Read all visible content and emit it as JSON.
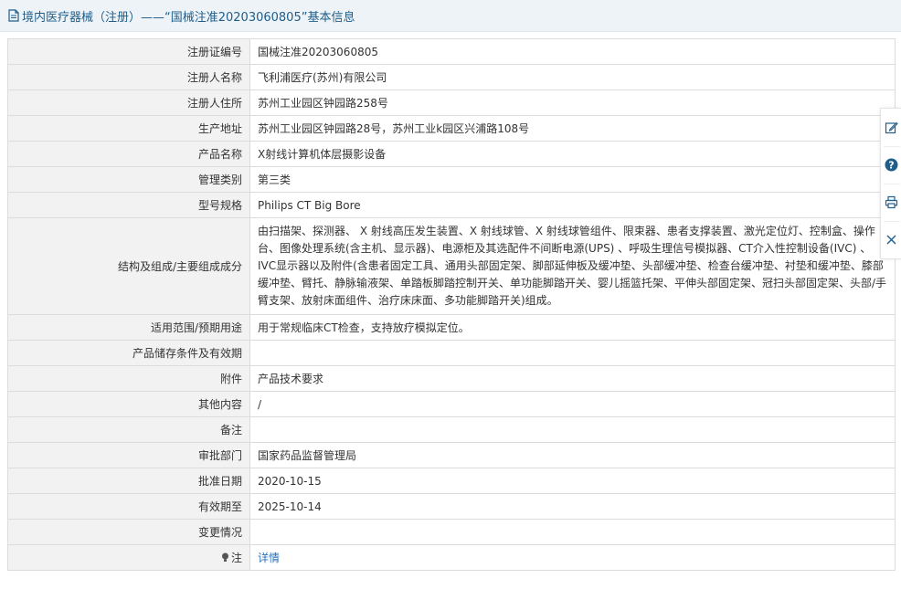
{
  "header": {
    "title": "境内医疗器械（注册）——“国械注准20203060805”基本信息"
  },
  "rows": [
    {
      "label": "注册证编号",
      "value": "国械注准20203060805"
    },
    {
      "label": "注册人名称",
      "value": "飞利浦医疗(苏州)有限公司"
    },
    {
      "label": "注册人住所",
      "value": "苏州工业园区钟园路258号"
    },
    {
      "label": "生产地址",
      "value": "苏州工业园区钟园路28号，苏州工业k园区兴浦路108号"
    },
    {
      "label": "产品名称",
      "value": "X射线计算机体层摄影设备"
    },
    {
      "label": "管理类别",
      "value": "第三类"
    },
    {
      "label": "型号规格",
      "value": "Philips CT Big Bore"
    },
    {
      "label": "结构及组成/主要组成成分",
      "value": "由扫描架、探测器、 X 射线高压发生装置、X 射线球管、X 射线球管组件、限束器、患者支撑装置、激光定位灯、控制盒、操作台、图像处理系统(含主机、显示器)、电源柜及其选配件不间断电源(UPS) 、呼吸生理信号模拟器、CT介入性控制设备(IVC) 、IVC显示器以及附件(含患者固定工具、通用头部固定架、脚部延伸板及缓冲垫、头部缓冲垫、检查台缓冲垫、衬垫和缓冲垫、膝部缓冲垫、臂托、静脉输液架、单踏板脚踏控制开关、单功能脚踏开关、婴儿摇篮托架、平伸头部固定架、冠扫头部固定架、头部/手臂支架、放射床面组件、治疗床床面、多功能脚踏开关)组成。"
    },
    {
      "label": "适用范围/预期用途",
      "value": "用于常规临床CT检查，支持放疗模拟定位。"
    },
    {
      "label": "产品储存条件及有效期",
      "value": ""
    },
    {
      "label": "附件",
      "value": "产品技术要求"
    },
    {
      "label": "其他内容",
      "value": "/"
    },
    {
      "label": "备注",
      "value": ""
    },
    {
      "label": "审批部门",
      "value": "国家药品监督管理局"
    },
    {
      "label": "批准日期",
      "value": "2020-10-15"
    },
    {
      "label": "有效期至",
      "value": "2025-10-14"
    },
    {
      "label": "变更情况",
      "value": ""
    },
    {
      "label": "注",
      "value": "详情"
    }
  ],
  "side_tools": [
    {
      "icon": "edit-icon"
    },
    {
      "icon": "help-icon",
      "color": "#1f5d8a"
    },
    {
      "icon": "print-icon"
    },
    {
      "icon": "close-icon"
    }
  ]
}
